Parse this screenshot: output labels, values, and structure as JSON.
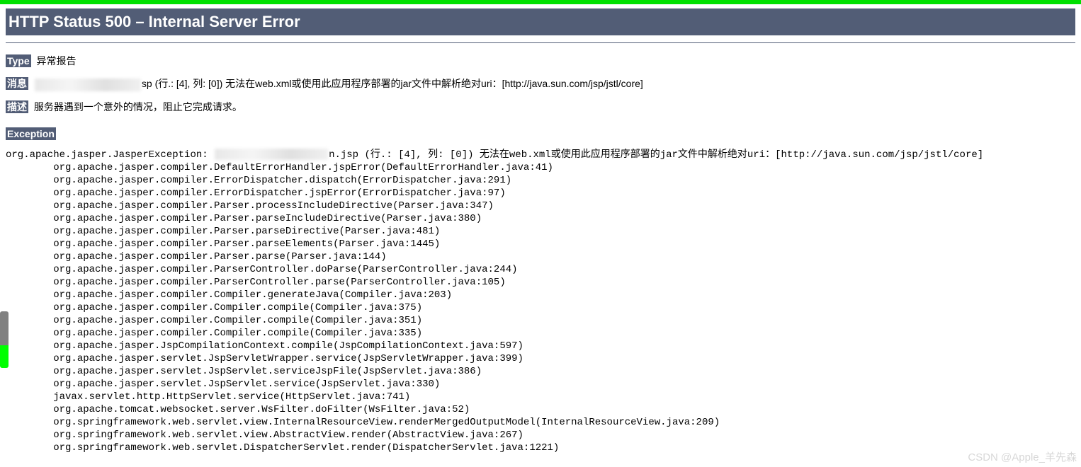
{
  "title": "HTTP Status 500 – Internal Server Error",
  "labels": {
    "type": "Type",
    "message": "消息",
    "description": "描述",
    "exception": "Exception"
  },
  "type_value": "异常报告",
  "message_suffix": "sp (行.: [4], 列: [0]) 无法在web.xml或使用此应用程序部署的jar文件中解析绝对uri：[http://java.sun.com/jsp/jstl/core]",
  "description_value": "服务器遇到一个意外的情况，阻止它完成请求。",
  "stack_head_prefix": "org.apache.jasper.JasperException: ",
  "stack_head_suffix": "n.jsp (行.: [4], 列: [0]) 无法在web.xml或使用此应用程序部署的jar文件中解析绝对uri：[http://java.sun.com/jsp/jstl/core]",
  "stack_lines": [
    "org.apache.jasper.compiler.DefaultErrorHandler.jspError(DefaultErrorHandler.java:41)",
    "org.apache.jasper.compiler.ErrorDispatcher.dispatch(ErrorDispatcher.java:291)",
    "org.apache.jasper.compiler.ErrorDispatcher.jspError(ErrorDispatcher.java:97)",
    "org.apache.jasper.compiler.Parser.processIncludeDirective(Parser.java:347)",
    "org.apache.jasper.compiler.Parser.parseIncludeDirective(Parser.java:380)",
    "org.apache.jasper.compiler.Parser.parseDirective(Parser.java:481)",
    "org.apache.jasper.compiler.Parser.parseElements(Parser.java:1445)",
    "org.apache.jasper.compiler.Parser.parse(Parser.java:144)",
    "org.apache.jasper.compiler.ParserController.doParse(ParserController.java:244)",
    "org.apache.jasper.compiler.ParserController.parse(ParserController.java:105)",
    "org.apache.jasper.compiler.Compiler.generateJava(Compiler.java:203)",
    "org.apache.jasper.compiler.Compiler.compile(Compiler.java:375)",
    "org.apache.jasper.compiler.Compiler.compile(Compiler.java:351)",
    "org.apache.jasper.compiler.Compiler.compile(Compiler.java:335)",
    "org.apache.jasper.JspCompilationContext.compile(JspCompilationContext.java:597)",
    "org.apache.jasper.servlet.JspServletWrapper.service(JspServletWrapper.java:399)",
    "org.apache.jasper.servlet.JspServlet.serviceJspFile(JspServlet.java:386)",
    "org.apache.jasper.servlet.JspServlet.service(JspServlet.java:330)",
    "javax.servlet.http.HttpServlet.service(HttpServlet.java:741)",
    "org.apache.tomcat.websocket.server.WsFilter.doFilter(WsFilter.java:52)",
    "org.springframework.web.servlet.view.InternalResourceView.renderMergedOutputModel(InternalResourceView.java:209)",
    "org.springframework.web.servlet.view.AbstractView.render(AbstractView.java:267)",
    "org.springframework.web.servlet.DispatcherServlet.render(DispatcherServlet.java:1221)"
  ],
  "watermark": "CSDN @Apple_羊先森"
}
